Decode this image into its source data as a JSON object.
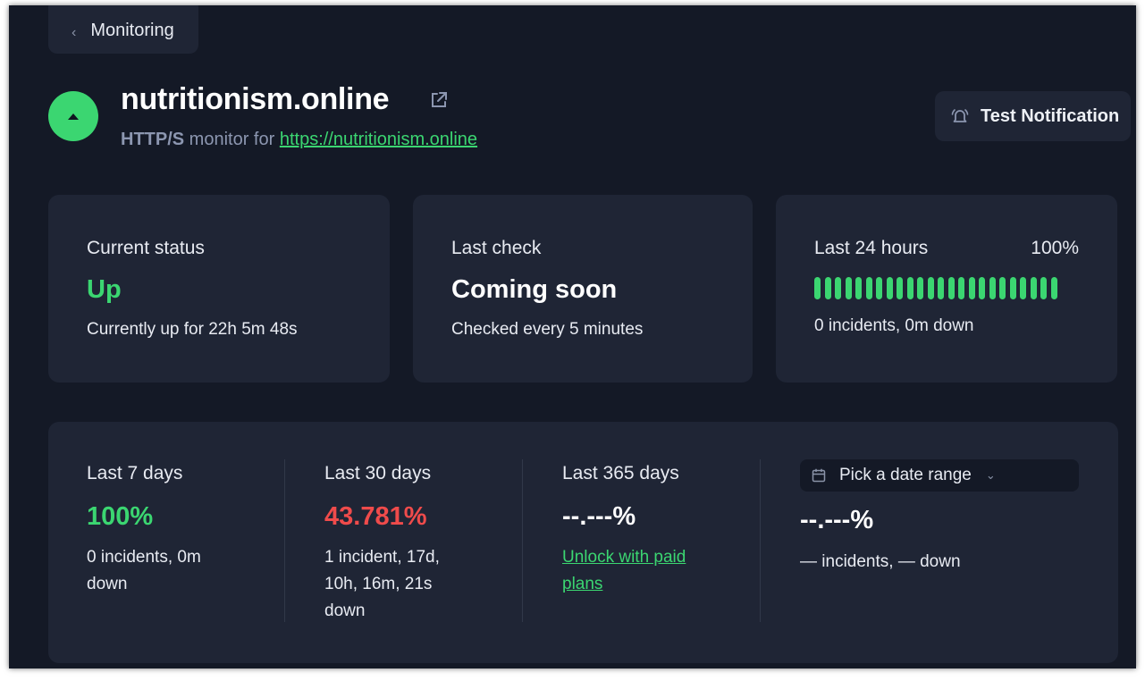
{
  "nav": {
    "back_label": "Monitoring"
  },
  "monitor": {
    "name": "nutritionism.online",
    "protocol": "HTTP/S",
    "monitor_for_text": " monitor for ",
    "url": "https://nutritionism.online",
    "status": "up"
  },
  "actions": {
    "test_notification_label": "Test Notification"
  },
  "cards": {
    "current_status": {
      "label": "Current status",
      "value": "Up",
      "detail": "Currently up for 22h 5m 48s"
    },
    "last_check": {
      "label": "Last check",
      "value": "Coming soon",
      "detail": "Checked every 5 minutes"
    },
    "last_24h": {
      "label": "Last 24 hours",
      "percent": "100%",
      "detail": "0 incidents, 0m down",
      "bar_count": 24,
      "bar_color": "#3bd671"
    }
  },
  "stats": {
    "last_7_days": {
      "label": "Last 7 days",
      "value": "100%",
      "detail": "0 incidents, 0m down"
    },
    "last_30_days": {
      "label": "Last 30 days",
      "value": "43.781%",
      "detail": "1 incident, 17d, 10h, 16m, 21s down"
    },
    "last_365_days": {
      "label": "Last 365 days",
      "value": "--.---%",
      "link": "Unlock with paid plans"
    },
    "custom": {
      "picker_label": "Pick a date range",
      "value": "--.---%",
      "detail": "— incidents, — down"
    }
  },
  "colors": {
    "accent_green": "#3bd671",
    "danger_red": "#ef4b4b",
    "background": "#141926",
    "card": "#1f2535"
  },
  "icons": [
    "chevron-left-icon",
    "chevron-up-icon",
    "external-link-icon",
    "bell-icon",
    "calendar-icon",
    "chevron-down-icon"
  ]
}
